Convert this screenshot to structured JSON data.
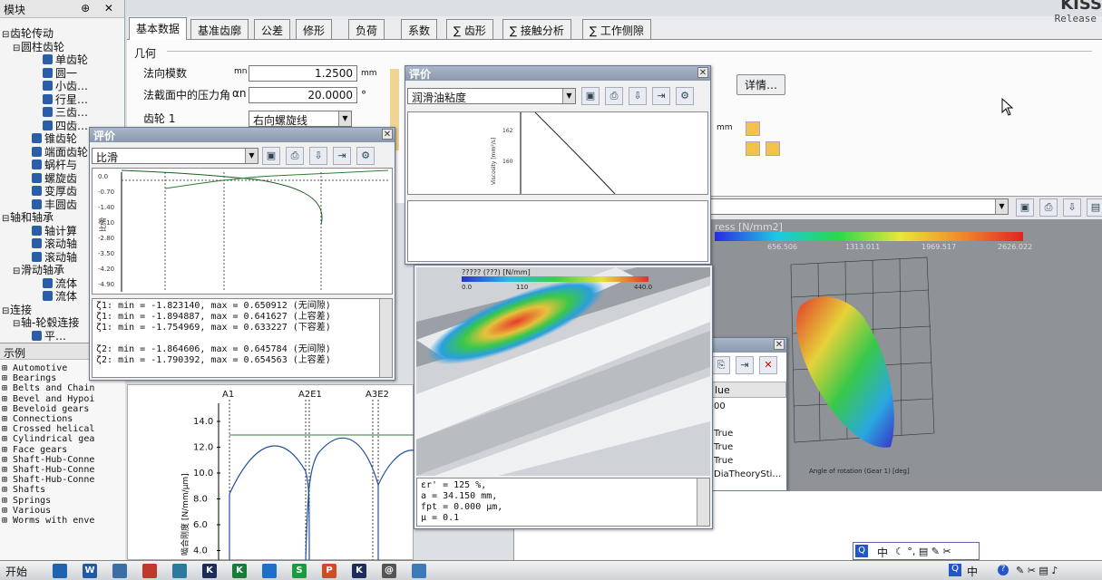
{
  "brand": {
    "name": "KISS",
    "release": "Release"
  },
  "left_panel": {
    "title": "模块",
    "controls": "⊕ ✕",
    "tree": [
      {
        "label": "齿轮传动",
        "pm": "⊟",
        "indent": 0
      },
      {
        "label": "圆柱齿轮",
        "pm": "⊟",
        "indent": 1
      },
      {
        "label": "单齿轮",
        "pm": "",
        "indent": 3
      },
      {
        "label": "圆一",
        "pm": "",
        "indent": 3
      },
      {
        "label": "小齿…",
        "pm": "",
        "indent": 3
      },
      {
        "label": "行星…",
        "pm": "",
        "indent": 3
      },
      {
        "label": "三齿…",
        "pm": "",
        "indent": 3
      },
      {
        "label": "四齿…",
        "pm": "",
        "indent": 3
      },
      {
        "label": "锥齿轮",
        "pm": "",
        "indent": 2
      },
      {
        "label": "端面齿轮",
        "pm": "",
        "indent": 2
      },
      {
        "label": "蜗杆与",
        "pm": "",
        "indent": 2
      },
      {
        "label": "螺旋齿",
        "pm": "",
        "indent": 2
      },
      {
        "label": "变厚齿",
        "pm": "",
        "indent": 2
      },
      {
        "label": "丰圆齿",
        "pm": "",
        "indent": 2
      },
      {
        "label": "轴和轴承",
        "pm": "⊟",
        "indent": 0
      },
      {
        "label": "轴计算",
        "pm": "",
        "indent": 2
      },
      {
        "label": "滚动轴",
        "pm": "",
        "indent": 2
      },
      {
        "label": "滚动轴",
        "pm": "",
        "indent": 2
      },
      {
        "label": "滑动轴承",
        "pm": "⊟",
        "indent": 1
      },
      {
        "label": "流体",
        "pm": "",
        "indent": 3
      },
      {
        "label": "流体",
        "pm": "",
        "indent": 3
      },
      {
        "label": "连接",
        "pm": "⊟",
        "indent": 0
      },
      {
        "label": "轴-轮毂连接",
        "pm": "⊟",
        "indent": 1
      },
      {
        "label": "平…",
        "pm": "",
        "indent": 2
      }
    ]
  },
  "examples": {
    "title": "示例",
    "items": [
      "Automotive",
      "Bearings",
      "Belts and Chain",
      "Bevel and Hypoi",
      "Beveloid gears",
      "Connections",
      "Crossed helical",
      "Cylindrical gea",
      "Face gears",
      "Shaft-Hub-Conne",
      "Shaft-Hub-Conne",
      "Shaft-Hub-Conne",
      "Shafts",
      "Springs",
      "Various",
      "Worms with enve"
    ]
  },
  "tabs": [
    "基本数据",
    "基准齿廓",
    "公差",
    "修形",
    "负荷",
    "系数",
    "∑ 齿形",
    "∑ 接触分析",
    "∑ 工作侧隙"
  ],
  "geometry": {
    "group_title": "几何",
    "module_label": "法向模数",
    "module_symbol": "mn",
    "module_value": "1.2500",
    "module_unit": "mm",
    "pressure_label": "法截面中的压力角",
    "pressure_symbol": "αn",
    "pressure_value": "20.0000",
    "pressure_unit": "°",
    "gear_label": "齿轮 1",
    "gear_value": "右向螺旋线",
    "details_button": "详情…",
    "unit_mm": "mm"
  },
  "slide_window": {
    "title": "评价",
    "select": "比滑",
    "results": [
      "ζ1: min = -1.823140, max = 0.650912 (无间隙)",
      "ζ1: min = -1.894887, max = 0.641627 (上容差)",
      "ζ1: min = -1.754969, max = 0.633227 (下容差)",
      "",
      "ζ2: min = -1.864606, max = 0.645784 (无间隙)",
      "ζ2: min = -1.790392, max = 0.654563 (上容差)"
    ]
  },
  "visc_window": {
    "title": "评价",
    "select": "润滑油粘度",
    "ylabel": "Viscosity [mm²/s]"
  },
  "stress_window": {
    "header": "????? (???) [N/mm]",
    "scale_min": "0.0",
    "scale_mid": "110",
    "scale_max": "440.0",
    "results": [
      "εr' = 125 %,",
      "a = 34.150 mm,",
      "fpt = 0.000 μm,",
      "μ = 0.1"
    ]
  },
  "stress3d": {
    "title": "ress [N/mm2]",
    "ticks": [
      "656.506",
      "1313.011",
      "1969.517",
      "2626.022"
    ],
    "xaxis": "Angle of rotation (Gear 1) [deg]"
  },
  "props_panel": {
    "header": "lue",
    "rows": [
      "00",
      "",
      "True",
      "True",
      "True",
      "DiaTheorySti…"
    ]
  },
  "mesh_chart": {
    "markers": [
      "A1",
      "A2E1",
      "A3E2"
    ],
    "yticks": [
      "14.0",
      "12.0",
      "10.0",
      "8.0",
      "6.0",
      "4.0"
    ],
    "ylabel": "啮合刚度 [N/mm/μm]"
  },
  "slide_chart": {
    "yticks": [
      "0.0",
      "-0.70",
      "-1.40",
      "-2.10",
      "-2.80",
      "-3.50",
      "-4.20",
      "-4.90"
    ],
    "ylabel": "比滑"
  },
  "visc_chart": {
    "yticks": [
      "162",
      "160"
    ]
  },
  "ime": {
    "lang": "中",
    "icons": "☾ °, ▤ ✎ ✂"
  },
  "taskbar": {
    "start": "开始",
    "apps": [
      {
        "label": "",
        "color": "#1e63b0"
      },
      {
        "label": "W",
        "color": "#1f5aa8"
      },
      {
        "label": "",
        "color": "#3a6ea5"
      },
      {
        "label": "",
        "color": "#c0392b"
      },
      {
        "label": "",
        "color": "#2b7a9e"
      },
      {
        "label": "K",
        "color": "#1d2d5a"
      },
      {
        "label": "K",
        "color": "#1a7a3a"
      },
      {
        "label": "",
        "color": "#1f6fc9"
      },
      {
        "label": "S",
        "color": "#1e9a3e"
      },
      {
        "label": "P",
        "color": "#d24a26"
      },
      {
        "label": "K",
        "color": "#1d2d5a"
      },
      {
        "label": "@",
        "color": "#555"
      },
      {
        "label": "",
        "color": "#3b7ab8"
      }
    ],
    "tray": "中"
  }
}
